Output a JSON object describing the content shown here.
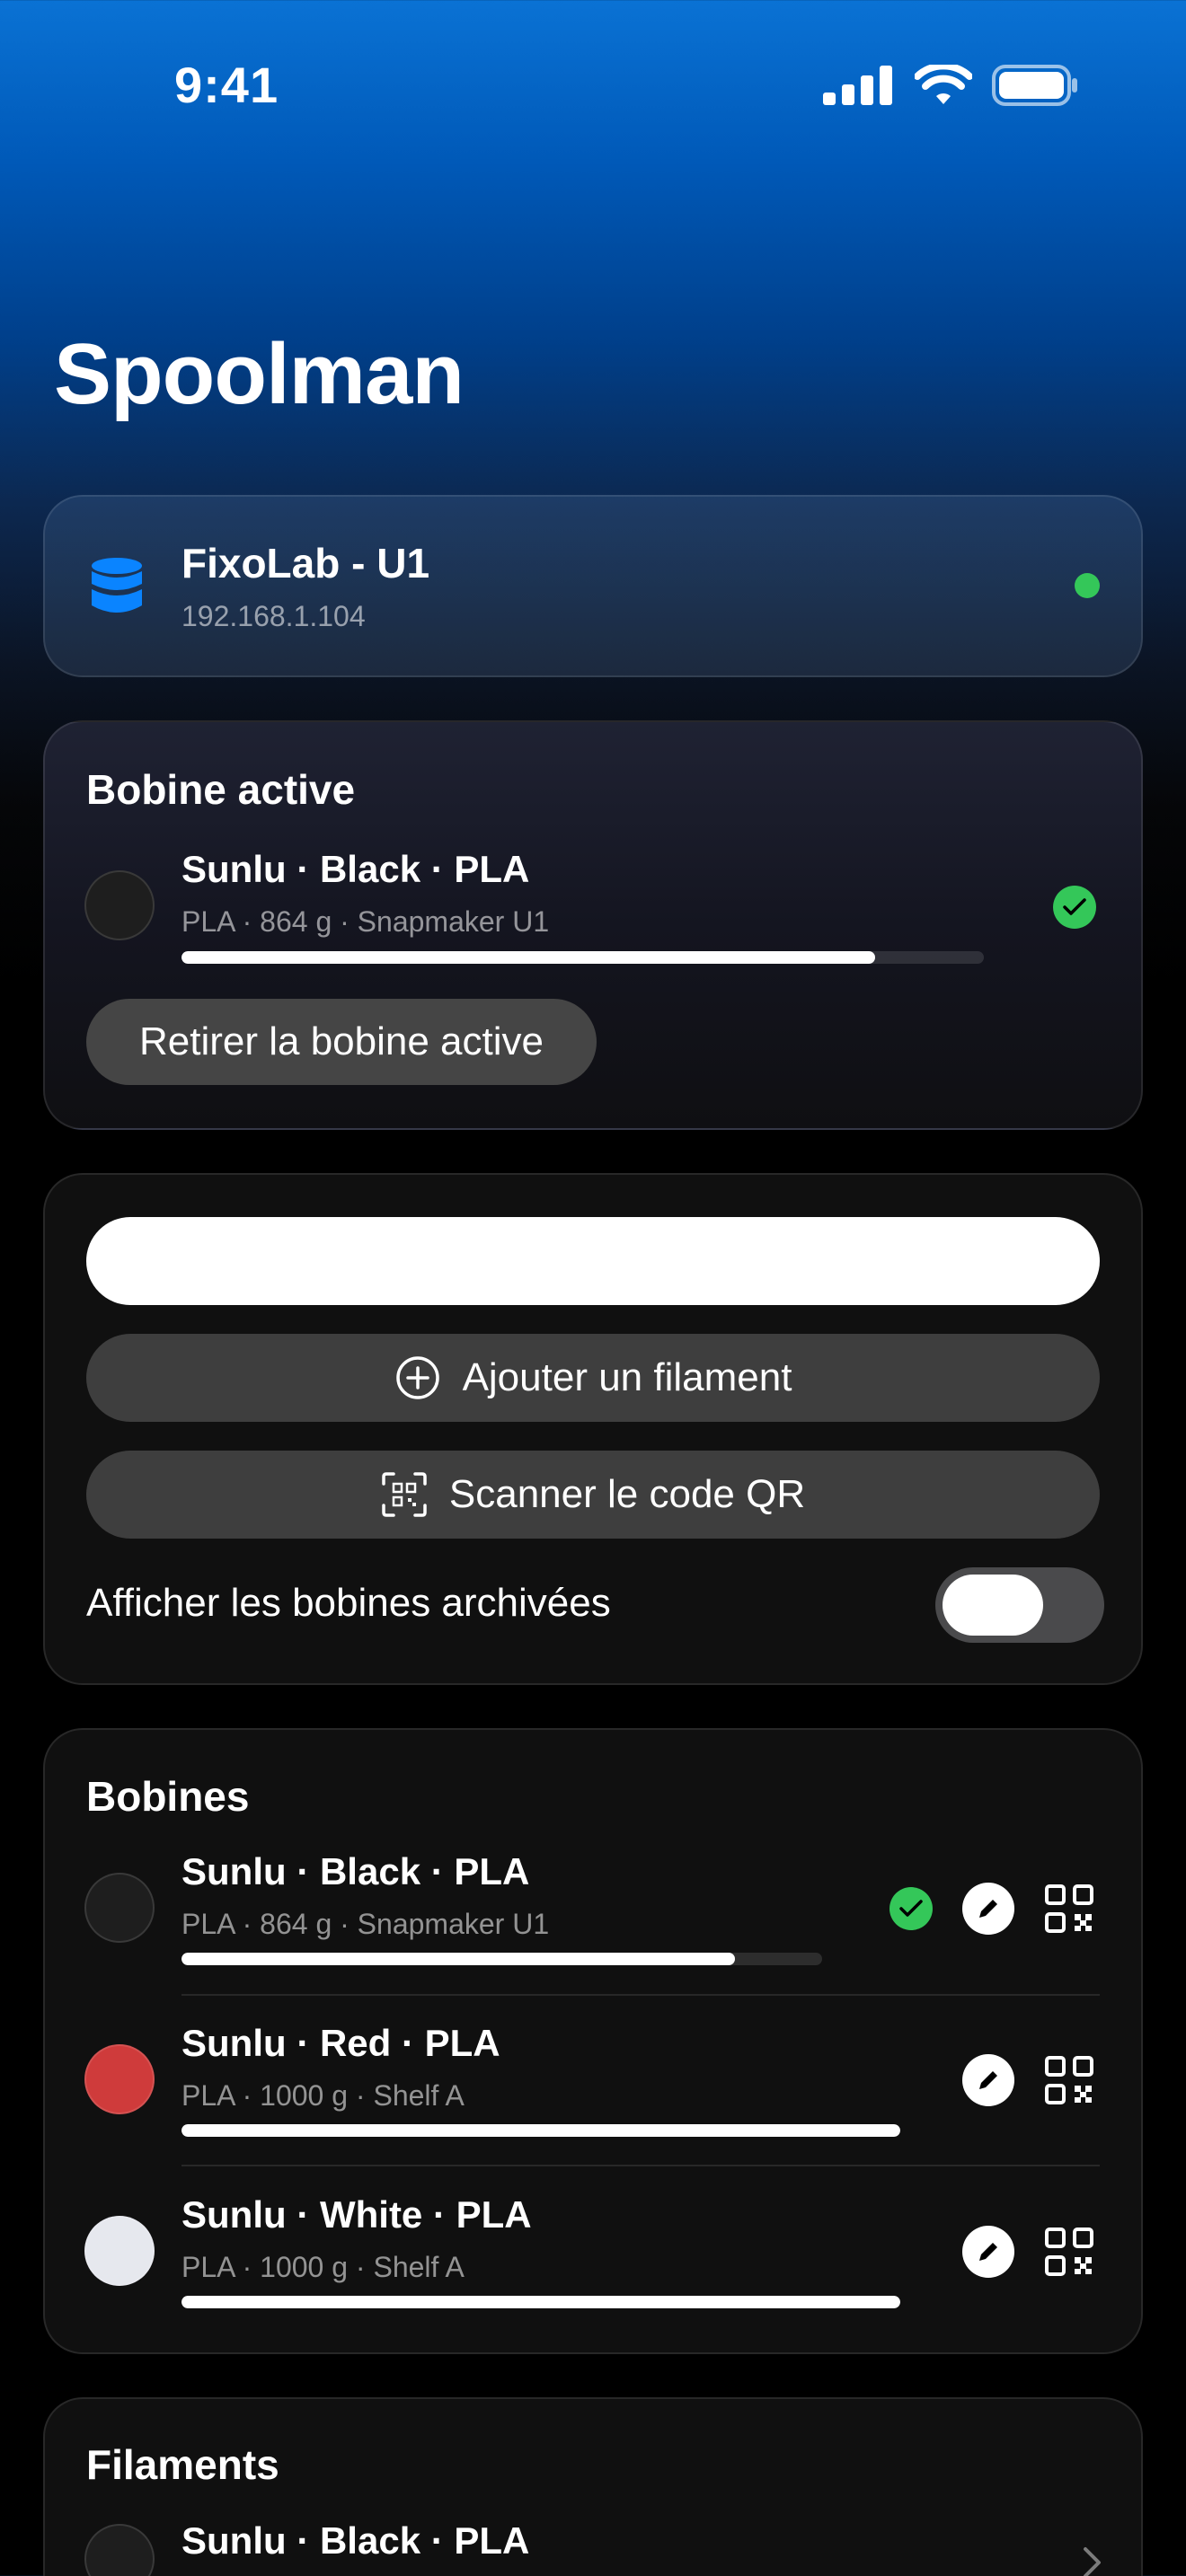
{
  "status_bar": {
    "time": "9:41"
  },
  "page_title": "Spoolman",
  "server": {
    "name": "FixoLab - U1",
    "address": "192.168.1.104",
    "status_color": "#34c759"
  },
  "active_spool": {
    "section_title": "Bobine active",
    "name": "Sunlu · Black · PLA",
    "meta": "PLA · 864 g · Snapmaker U1",
    "remaining_fraction": 0.864,
    "color": "#1e1e1e",
    "remove_label": "Retirer la bobine active"
  },
  "controls": {
    "search_value": "",
    "search_placeholder": "",
    "add_filament_label": "Ajouter un filament",
    "scan_qr_label": "Scanner le code QR",
    "show_archived_label": "Afficher les bobines archivées",
    "show_archived": false
  },
  "spools": {
    "section_title": "Bobines",
    "items": [
      {
        "name": "Sunlu · Black · PLA",
        "meta": "PLA · 864 g · Snapmaker U1",
        "color": "#1e1e1e",
        "remaining_fraction": 0.864,
        "active": true
      },
      {
        "name": "Sunlu · Red · PLA",
        "meta": "PLA · 1000 g · Shelf A",
        "color": "#cf3b3b",
        "remaining_fraction": 1.0,
        "active": false
      },
      {
        "name": "Sunlu · White · PLA",
        "meta": "PLA · 1000 g · Shelf A",
        "color": "#e6e8ee",
        "remaining_fraction": 1.0,
        "active": false
      }
    ]
  },
  "filaments": {
    "section_title": "Filaments",
    "items": [
      {
        "name": "Sunlu · Black · PLA",
        "color": "#1e1e1e"
      }
    ]
  },
  "colors": {
    "accent": "#0a84ff",
    "success": "#34c759"
  }
}
